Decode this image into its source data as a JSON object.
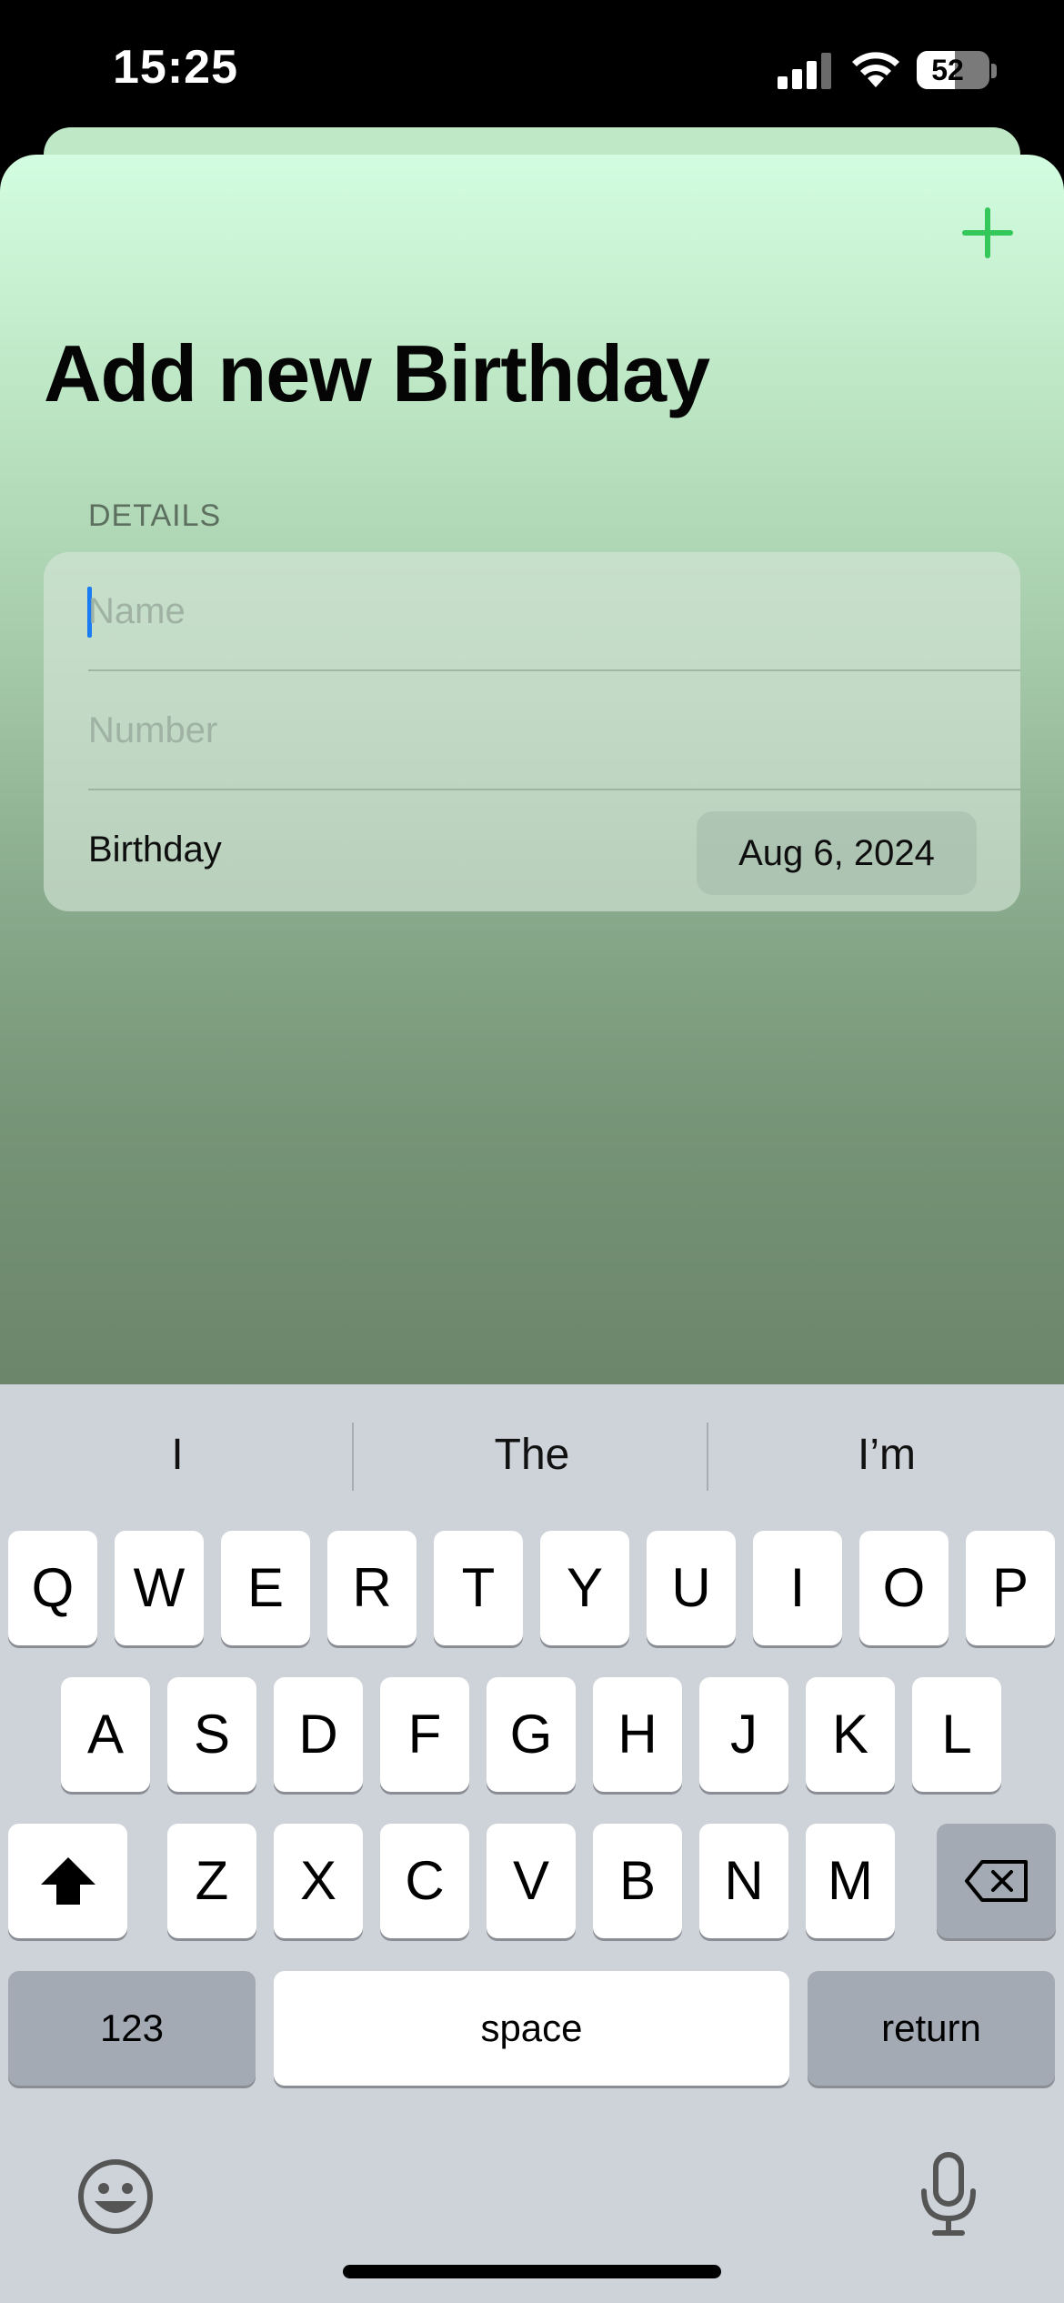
{
  "status": {
    "time": "15:25",
    "battery": "52",
    "battery_level": 0.52
  },
  "header": {
    "title": "Add new Birthday"
  },
  "form": {
    "section_header": "DETAILS",
    "name_placeholder": "Name",
    "number_placeholder": "Number",
    "birthday_label": "Birthday",
    "birthday_value": "Aug 6, 2024"
  },
  "keyboard": {
    "suggestions": [
      "I",
      "The",
      "I’m"
    ],
    "row1": [
      "Q",
      "W",
      "E",
      "R",
      "T",
      "Y",
      "U",
      "I",
      "O",
      "P"
    ],
    "row2": [
      "A",
      "S",
      "D",
      "F",
      "G",
      "H",
      "J",
      "K",
      "L"
    ],
    "row3": [
      "Z",
      "X",
      "C",
      "V",
      "B",
      "N",
      "M"
    ],
    "numbers_label": "123",
    "space_label": "space",
    "return_label": "return"
  },
  "colors": {
    "accent": "#34c759",
    "cursor": "#1a7cf5"
  },
  "icons": [
    "signal-icon",
    "wifi-icon",
    "battery-icon",
    "plus-icon",
    "shift-icon",
    "delete-icon",
    "emoji-icon",
    "microphone-icon"
  ]
}
